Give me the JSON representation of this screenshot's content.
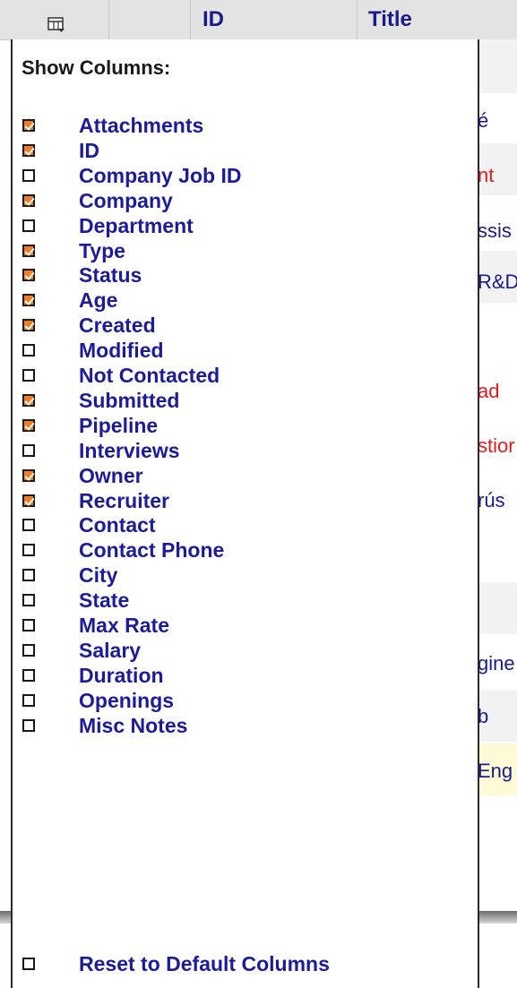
{
  "table": {
    "columns_icon": "columns-icon",
    "header": {
      "id_label": "ID",
      "title_label": "Title"
    },
    "rows_visible_right": [
      {
        "text": "é",
        "color": "#1a1a8c"
      },
      {
        "text": "nt",
        "color": "#e51a1a"
      },
      {
        "text": "ssis",
        "color": "#1a1a8c"
      },
      {
        "text": "R&D",
        "color": "#1a1a8c"
      },
      {
        "text": "ad",
        "color": "#e51a1a"
      },
      {
        "text": "stior",
        "color": "#e51a1a"
      },
      {
        "text": "rús",
        "color": "#1a1a8c"
      },
      {
        "text": "gine",
        "color": "#1a1a8c"
      },
      {
        "text": "b",
        "color": "#1a1a8c"
      },
      {
        "text": "Eng",
        "color": "#1a1a8c"
      }
    ]
  },
  "menu": {
    "title": "Show Columns:",
    "items": [
      {
        "label": "Attachments",
        "checked": true
      },
      {
        "label": "ID",
        "checked": true
      },
      {
        "label": "Company Job ID",
        "checked": false
      },
      {
        "label": "Company",
        "checked": true
      },
      {
        "label": "Department",
        "checked": false
      },
      {
        "label": "Type",
        "checked": true
      },
      {
        "label": "Status",
        "checked": true
      },
      {
        "label": "Age",
        "checked": true
      },
      {
        "label": "Created",
        "checked": true
      },
      {
        "label": "Modified",
        "checked": false
      },
      {
        "label": "Not Contacted",
        "checked": false
      },
      {
        "label": "Submitted",
        "checked": true
      },
      {
        "label": "Pipeline",
        "checked": true
      },
      {
        "label": "Interviews",
        "checked": false
      },
      {
        "label": "Owner",
        "checked": true
      },
      {
        "label": "Recruiter",
        "checked": true
      },
      {
        "label": "Contact",
        "checked": false
      },
      {
        "label": "Contact Phone",
        "checked": false
      },
      {
        "label": "City",
        "checked": false
      },
      {
        "label": "State",
        "checked": false
      },
      {
        "label": "Max Rate",
        "checked": false
      },
      {
        "label": "Salary",
        "checked": false
      },
      {
        "label": "Duration",
        "checked": false
      },
      {
        "label": "Openings",
        "checked": false
      },
      {
        "label": "Misc Notes",
        "checked": false
      }
    ],
    "reset": {
      "label": "Reset to Default Columns",
      "checked": false
    }
  },
  "colors": {
    "checkbox_checked": "#f07d21",
    "link_blue": "#1c1c98",
    "alert_red": "#e51a1a"
  }
}
